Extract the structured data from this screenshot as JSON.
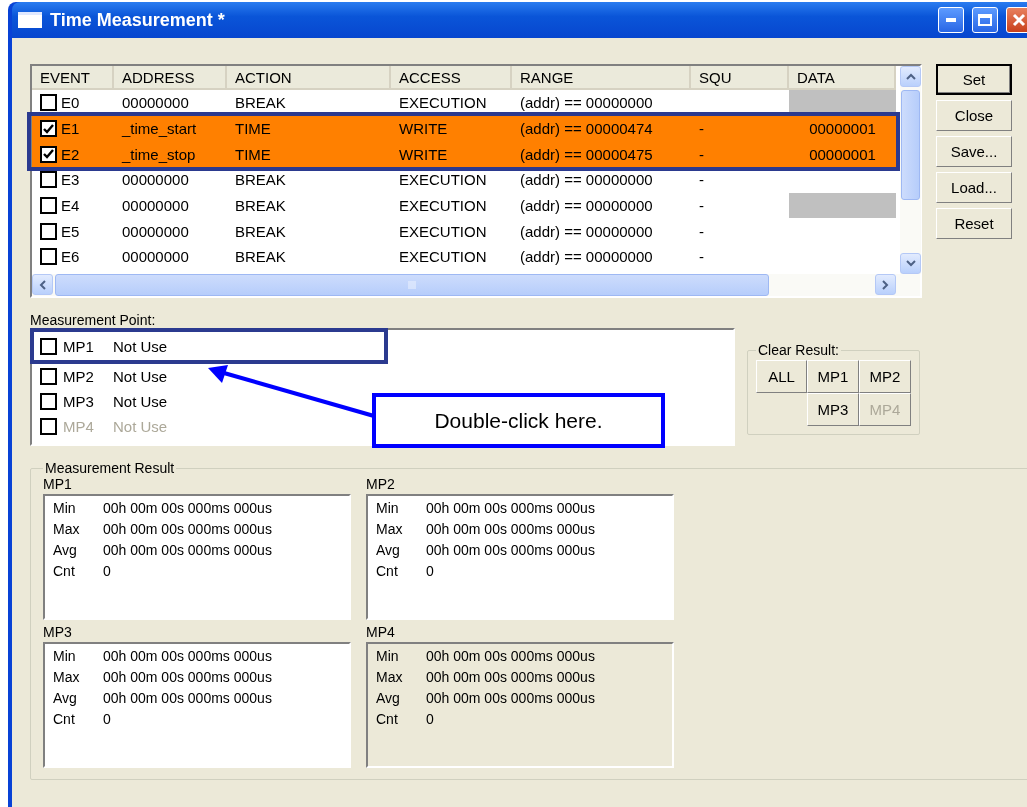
{
  "window": {
    "title": "Time Measurement *"
  },
  "events": {
    "columns": [
      "EVENT",
      "ADDRESS",
      "ACTION",
      "ACCESS",
      "RANGE",
      "SQU",
      "DATA"
    ],
    "rows": [
      {
        "checked": false,
        "highlighted": false,
        "data_shaded": true,
        "event": "E0",
        "address": "00000000",
        "action": "BREAK",
        "access": "EXECUTION",
        "range": "(addr) == 00000000"
      },
      {
        "checked": true,
        "highlighted": true,
        "data_shaded": false,
        "event": "E1",
        "address": "_time_start",
        "action": "TIME",
        "access": "WRITE",
        "range": "(addr) == 00000474",
        "squ": "-",
        "data": "00000001"
      },
      {
        "checked": true,
        "highlighted": true,
        "data_shaded": false,
        "event": "E2",
        "address": "_time_stop",
        "action": "TIME",
        "access": "WRITE",
        "range": "(addr) == 00000475",
        "squ": "-",
        "data": "00000001"
      },
      {
        "checked": false,
        "highlighted": false,
        "data_shaded": false,
        "event": "E3",
        "address": "00000000",
        "action": "BREAK",
        "access": "EXECUTION",
        "range": "(addr) == 00000000",
        "squ": "-"
      },
      {
        "checked": false,
        "highlighted": false,
        "data_shaded": true,
        "event": "E4",
        "address": "00000000",
        "action": "BREAK",
        "access": "EXECUTION",
        "range": "(addr) == 00000000",
        "squ": "-"
      },
      {
        "checked": false,
        "highlighted": false,
        "data_shaded": false,
        "event": "E5",
        "address": "00000000",
        "action": "BREAK",
        "access": "EXECUTION",
        "range": "(addr) == 00000000",
        "squ": "-"
      },
      {
        "checked": false,
        "highlighted": false,
        "data_shaded": false,
        "event": "E6",
        "address": "00000000",
        "action": "BREAK",
        "access": "EXECUTION",
        "range": "(addr) == 00000000",
        "squ": "-"
      }
    ]
  },
  "buttons": [
    {
      "label": "Set",
      "default": true
    },
    {
      "label": "Close",
      "default": false
    },
    {
      "label": "Save...",
      "default": false
    },
    {
      "label": "Load...",
      "default": false
    },
    {
      "label": "Reset",
      "default": false
    }
  ],
  "measurement_point": {
    "label": "Measurement Point:",
    "items": [
      {
        "checked": false,
        "disabled": false,
        "name": "MP1",
        "status": "Not Use"
      },
      {
        "checked": false,
        "disabled": false,
        "name": "MP2",
        "status": "Not Use"
      },
      {
        "checked": false,
        "disabled": false,
        "name": "MP3",
        "status": "Not Use"
      },
      {
        "checked": false,
        "disabled": true,
        "name": "MP4",
        "status": "Not Use"
      }
    ]
  },
  "clear_result": {
    "label": "Clear Result:",
    "buttons": [
      {
        "label": "ALL",
        "disabled": false
      },
      {
        "label": "MP1",
        "disabled": false
      },
      {
        "label": "MP2",
        "disabled": false
      },
      {
        "label": "MP3",
        "disabled": false
      },
      {
        "label": "MP4",
        "disabled": true
      }
    ]
  },
  "measurement_result": {
    "label": "Measurement Result",
    "panels": [
      {
        "name": "MP1",
        "disabled": false,
        "rows": [
          {
            "label": "Min",
            "value": "00h 00m 00s 000ms 000us"
          },
          {
            "label": "Max",
            "value": "00h 00m 00s 000ms 000us"
          },
          {
            "label": "Avg",
            "value": "00h 00m 00s 000ms 000us"
          },
          {
            "label": "Cnt",
            "value": "0"
          }
        ]
      },
      {
        "name": "MP2",
        "disabled": false,
        "rows": [
          {
            "label": "Min",
            "value": "00h 00m 00s 000ms 000us"
          },
          {
            "label": "Max",
            "value": "00h 00m 00s 000ms 000us"
          },
          {
            "label": "Avg",
            "value": "00h 00m 00s 000ms 000us"
          },
          {
            "label": "Cnt",
            "value": "0"
          }
        ]
      },
      {
        "name": "MP3",
        "disabled": false,
        "rows": [
          {
            "label": "Min",
            "value": "00h 00m 00s 000ms 000us"
          },
          {
            "label": "Max",
            "value": "00h 00m 00s 000ms 000us"
          },
          {
            "label": "Avg",
            "value": "00h 00m 00s 000ms 000us"
          },
          {
            "label": "Cnt",
            "value": "0"
          }
        ]
      },
      {
        "name": "MP4",
        "disabled": true,
        "rows": [
          {
            "label": "Min",
            "value": "00h 00m 00s 000ms 000us"
          },
          {
            "label": "Max",
            "value": "00h 00m 00s 000ms 000us"
          },
          {
            "label": "Avg",
            "value": "00h 00m 00s 000ms 000us"
          },
          {
            "label": "Cnt",
            "value": "0"
          }
        ]
      }
    ]
  },
  "annotation": {
    "callout": "Double-click here."
  }
}
